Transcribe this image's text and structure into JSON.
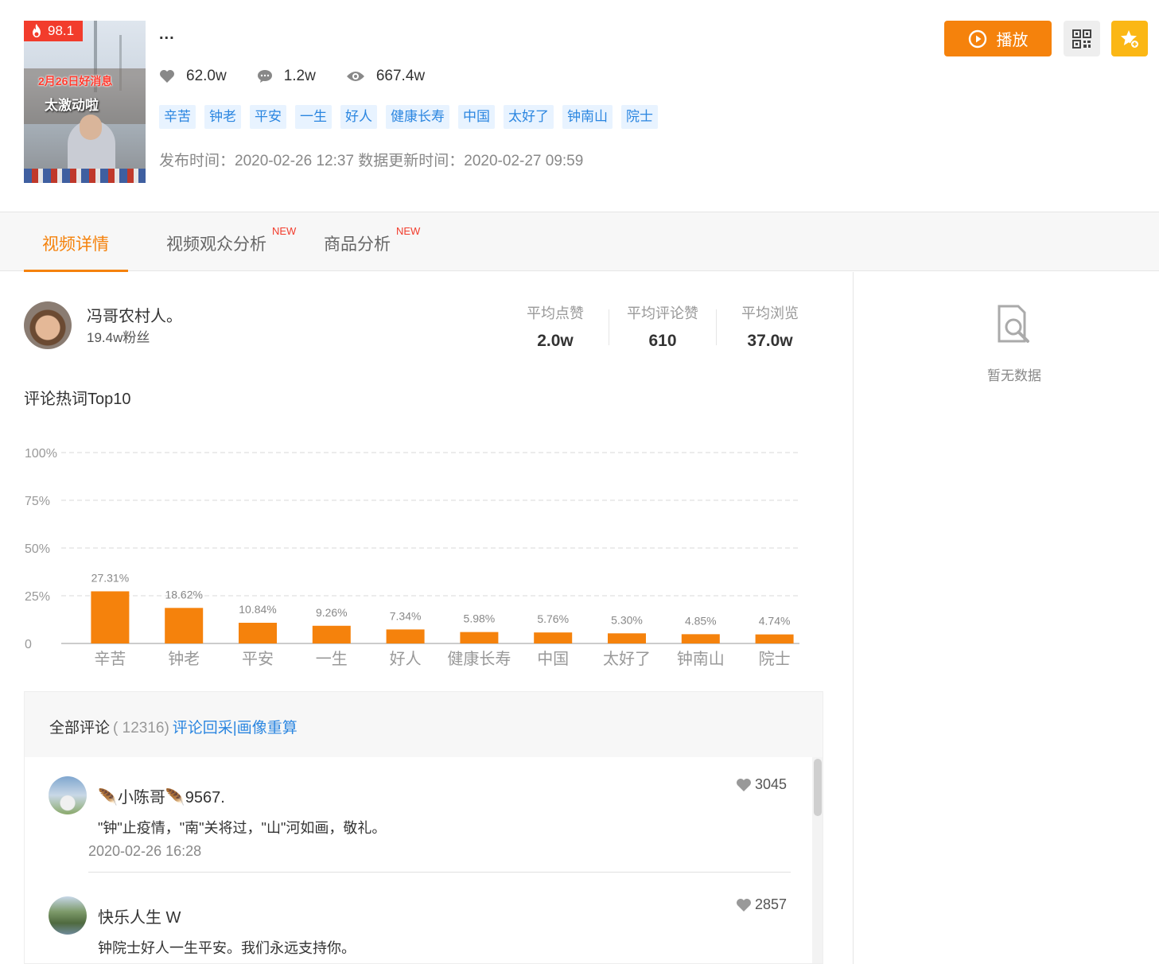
{
  "video": {
    "hot_score": "98.1",
    "thumbnail_text_1": "2月26日好消息",
    "thumbnail_text_2": "太激动啦",
    "title": "...",
    "likes": "62.0w",
    "comments": "1.2w",
    "views": "667.4w",
    "tags": [
      "辛苦",
      "钟老",
      "平安",
      "一生",
      "好人",
      "健康长寿",
      "中国",
      "太好了",
      "钟南山",
      "院士"
    ],
    "dates_text": "发布时间：2020-02-26 12:37 数据更新时间：2020-02-27 09:59"
  },
  "actions": {
    "play_label": "播放"
  },
  "tabs": [
    {
      "label": "视频详情",
      "active": true
    },
    {
      "label": "视频观众分析",
      "badge": "NEW"
    },
    {
      "label": "商品分析",
      "badge": "NEW"
    }
  ],
  "author": {
    "name": "冯哥农村人。",
    "fans": "19.4w粉丝",
    "avg_likes_label": "平均点赞",
    "avg_likes": "2.0w",
    "avg_comment_likes_label": "平均评论赞",
    "avg_comment_likes": "610",
    "avg_views_label": "平均浏览",
    "avg_views": "37.0w"
  },
  "side_panel": {
    "empty_text": "暂无数据"
  },
  "hot_words": {
    "title": "评论热词Top10"
  },
  "chart_data": {
    "type": "bar",
    "categories": [
      "辛苦",
      "钟老",
      "平安",
      "一生",
      "好人",
      "健康长寿",
      "中国",
      "太好了",
      "钟南山",
      "院士"
    ],
    "values": [
      27.31,
      18.62,
      10.84,
      9.26,
      7.34,
      5.98,
      5.76,
      5.3,
      4.85,
      4.74
    ],
    "value_labels": [
      "27.31%",
      "18.62%",
      "10.84%",
      "9.26%",
      "7.34%",
      "5.98%",
      "5.76%",
      "5.30%",
      "4.85%",
      "4.74%"
    ],
    "y_ticks": [
      "0",
      "25%",
      "50%",
      "75%",
      "100%"
    ],
    "ylim": [
      0,
      100
    ],
    "grid": true,
    "bar_color": "#f5820c"
  },
  "comments": {
    "label": "全部评论",
    "count": "( 12316)",
    "link": "评论回采|画像重算",
    "items": [
      {
        "name": "🪶小陈哥🪶9567.",
        "likes": "3045",
        "text": "\"钟\"止疫情，\"南\"关将过，\"山\"河如画，敬礼。",
        "time": "2020-02-26 16:28"
      },
      {
        "name": "快乐人生 W",
        "likes": "2857",
        "text": "钟院士好人一生平安。我们永远支持你。"
      }
    ]
  },
  "colors": {
    "accent": "#f5820c",
    "tag_text": "#2b86e0",
    "tag_bg": "#e8f3ff",
    "hot_badge": "#f23c2c",
    "fav": "#fbb715"
  }
}
